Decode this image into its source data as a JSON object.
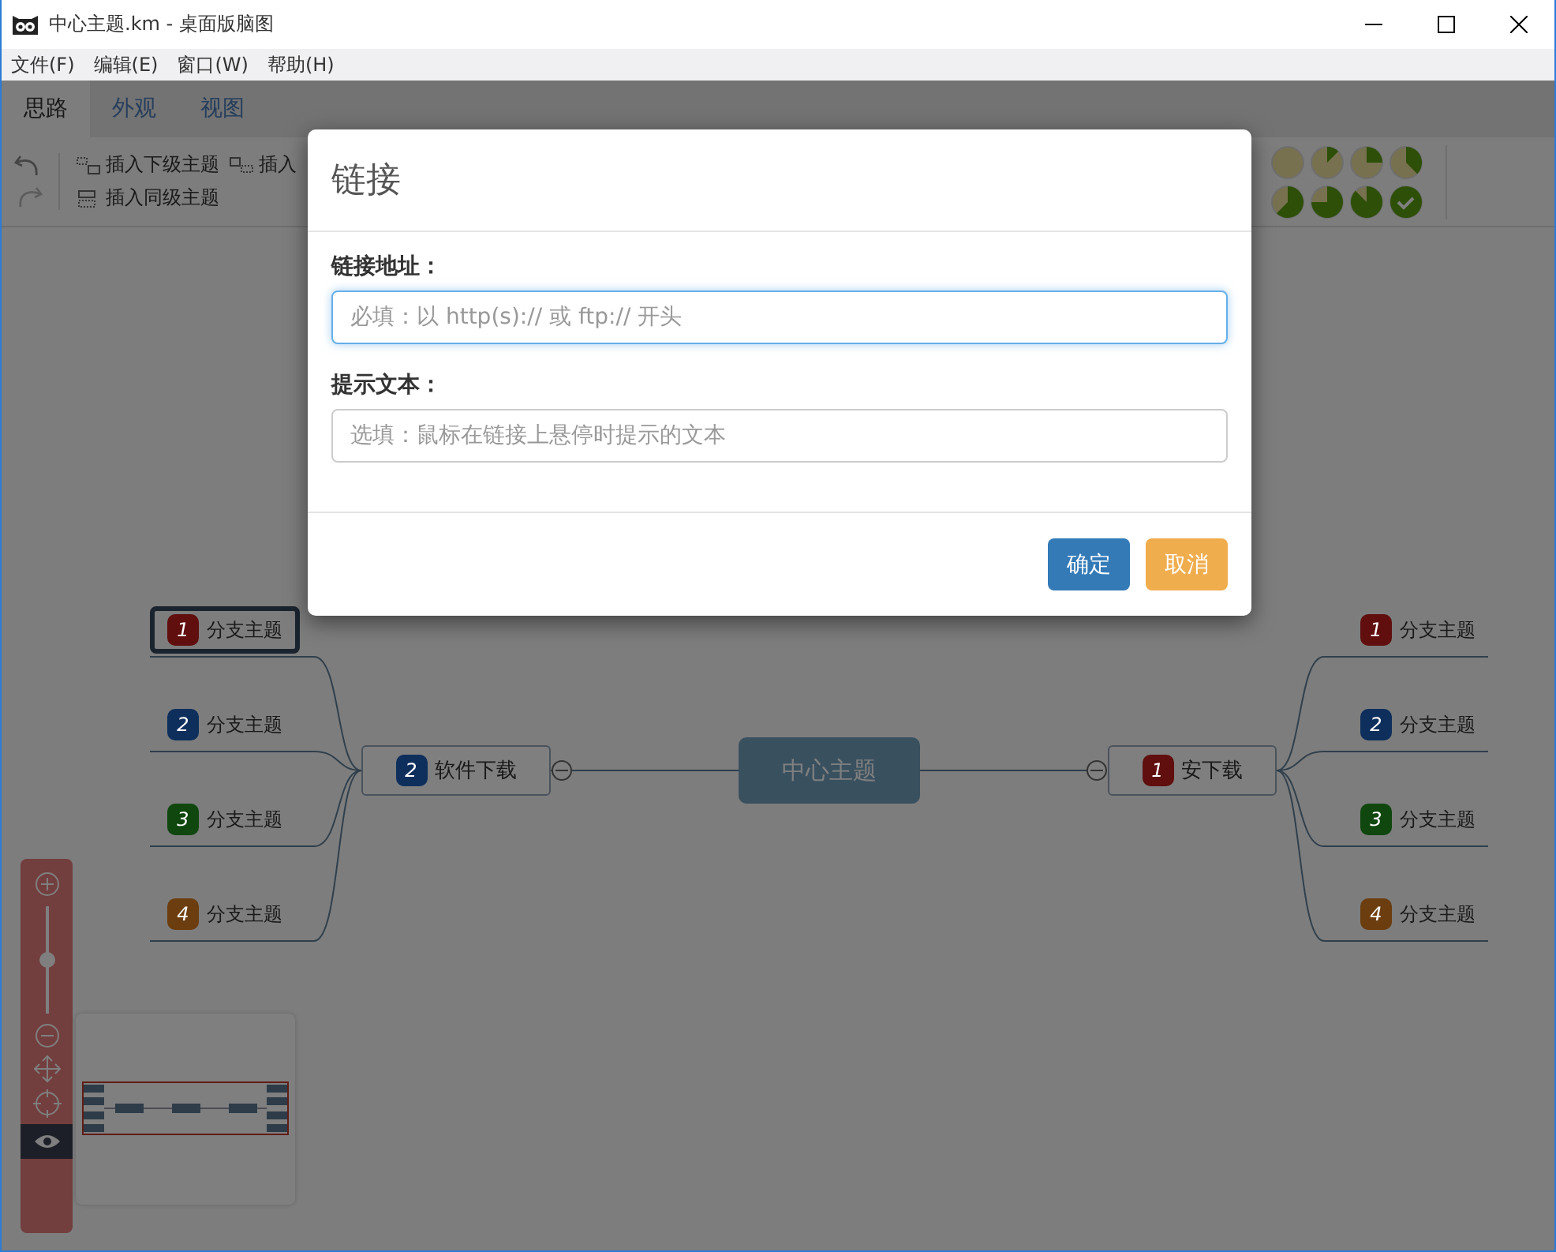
{
  "window": {
    "title": "中心主题.km - 桌面版脑图"
  },
  "menu": [
    "文件(F)",
    "编辑(E)",
    "窗口(W)",
    "帮助(H)"
  ],
  "tabs": [
    {
      "label": "思路",
      "selected": true
    },
    {
      "label": "外观",
      "selected": false
    },
    {
      "label": "视图",
      "selected": false
    }
  ],
  "toolbar": {
    "buttons": [
      {
        "label": "插入下级主题",
        "kind": "child"
      },
      {
        "label": "插入",
        "kind": "parent"
      },
      {
        "label": "插入同级主题",
        "kind": "sibling"
      }
    ]
  },
  "mind_map": {
    "root": {
      "text": "中心主题"
    },
    "branches": [
      {
        "text": "软件下载",
        "priority": "2",
        "color": "#0e2f5c",
        "selected": false,
        "children": [
          {
            "text": "分支主题",
            "priority": "1",
            "color": "#600f0e",
            "selected": true
          },
          {
            "text": "分支主题",
            "priority": "2",
            "color": "#0e2f5c",
            "selected": false
          },
          {
            "text": "分支主题",
            "priority": "3",
            "color": "#0f470f",
            "selected": false
          },
          {
            "text": "分支主题",
            "priority": "4",
            "color": "#6c3d0e",
            "selected": false
          }
        ]
      },
      {
        "text": "安下载",
        "priority": "1",
        "color": "#600f0e",
        "selected": false,
        "children": [
          {
            "text": "分支主题",
            "priority": "1",
            "color": "#600f0e",
            "selected": false
          },
          {
            "text": "分支主题",
            "priority": "2",
            "color": "#0e2f5c",
            "selected": false
          },
          {
            "text": "分支主题",
            "priority": "3",
            "color": "#0f470f",
            "selected": false
          },
          {
            "text": "分支主题",
            "priority": "4",
            "color": "#6c3d0e",
            "selected": false
          }
        ]
      }
    ]
  },
  "navigator": {
    "zoom": {
      "level": 0.5
    }
  },
  "dialog": {
    "title": "链接",
    "fields": [
      {
        "label": "链接地址：",
        "placeholder": "必填：以 http(s):// 或 ftp:// 开头",
        "focused": true
      },
      {
        "label": "提示文本：",
        "placeholder": "选填：鼠标在链接上悬停时提示的文本",
        "focused": false
      }
    ],
    "buttons": [
      {
        "label": "确定",
        "kind": "primary"
      },
      {
        "label": "取消",
        "kind": "warning"
      }
    ]
  }
}
